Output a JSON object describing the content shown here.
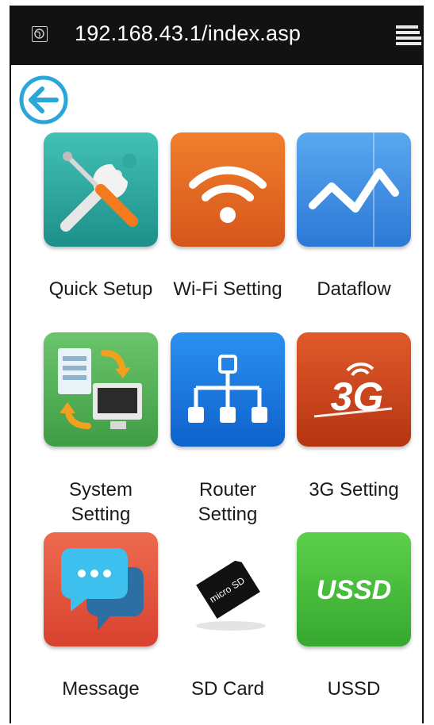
{
  "browser": {
    "url": "192.168.43.1/index.asp"
  },
  "icons": {
    "globe": "globe-icon",
    "menu": "menu-icon",
    "back": "back-arrow-icon"
  },
  "colors": {
    "topbar": "#121212",
    "back_accent": "#2aa7d8",
    "quick_setup": "#2aa7a0",
    "wifi": "#ea6a22",
    "dataflow": "#3f8fe0",
    "system": "#5cb45c",
    "router": "#1a7de0",
    "g3": "#d0441c",
    "message": "#e2533e",
    "sd_card": "#ffffff",
    "ussd": "#4cc23e"
  },
  "menu": {
    "items": [
      {
        "label": "Quick Setup"
      },
      {
        "label": "Wi-Fi Setting"
      },
      {
        "label": "Dataflow"
      },
      {
        "label": "System\nSetting"
      },
      {
        "label": "Router\nSetting"
      },
      {
        "label": "3G Setting"
      },
      {
        "label": "Message"
      },
      {
        "label": "SD Card"
      },
      {
        "label": "USSD"
      }
    ]
  },
  "tile_text": {
    "g3": "3G",
    "sd": "micro SD",
    "ussd": "USSD"
  }
}
